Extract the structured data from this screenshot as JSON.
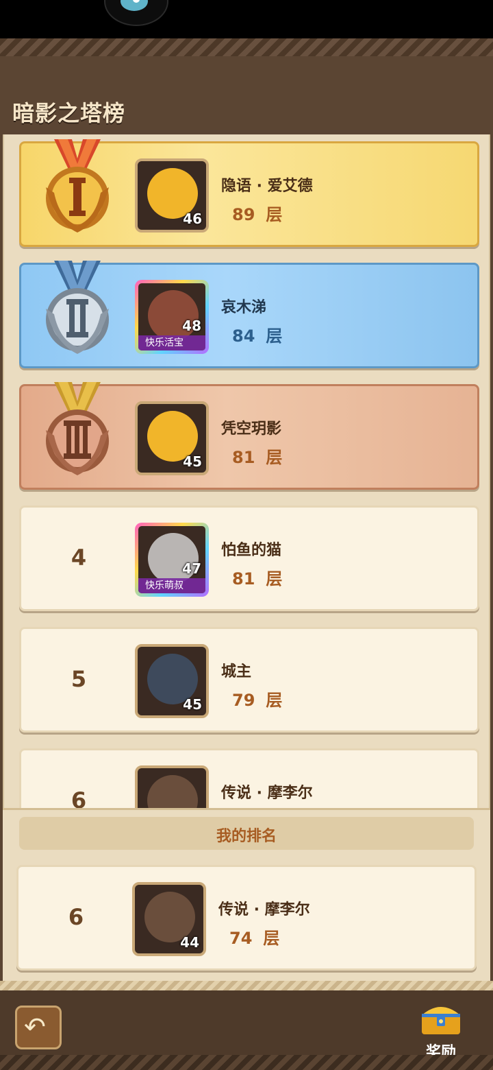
{
  "title": "暗影之塔榜",
  "floor_unit": "层",
  "ranking": [
    {
      "rank": "1",
      "name": "隐语 · 爱艾德",
      "floors": "89",
      "level": "46",
      "tag": "",
      "avatar_color": "#f1b52a"
    },
    {
      "rank": "2",
      "name": "哀木涕",
      "floors": "84",
      "level": "48",
      "tag": "快乐活宝",
      "avatar_color": "#8b4a38"
    },
    {
      "rank": "3",
      "name": "凭空玥影",
      "floors": "81",
      "level": "45",
      "tag": "",
      "avatar_color": "#f1b52a"
    },
    {
      "rank": "4",
      "name": "怕鱼的猫",
      "floors": "81",
      "level": "47",
      "tag": "快乐萌叔",
      "avatar_color": "#b9b5b3"
    },
    {
      "rank": "5",
      "name": "城主",
      "floors": "79",
      "level": "45",
      "tag": "",
      "avatar_color": "#3e4a5c"
    },
    {
      "rank": "6",
      "name": "传说 · 摩李尔",
      "floors": "",
      "level": "",
      "tag": "",
      "avatar_color": "#6a4e3c"
    }
  ],
  "my_rank": {
    "label": "我的排名",
    "rank": "6",
    "name": "传说 · 摩李尔",
    "floors": "74",
    "level": "44"
  },
  "footer": {
    "back_icon": "back-arrow-icon",
    "reward_label": "奖励"
  },
  "colors": {
    "gold": "#f7d66a",
    "silver": "#8fc8f4",
    "bronze": "#e3aa8a",
    "accent": "#a75c22"
  }
}
